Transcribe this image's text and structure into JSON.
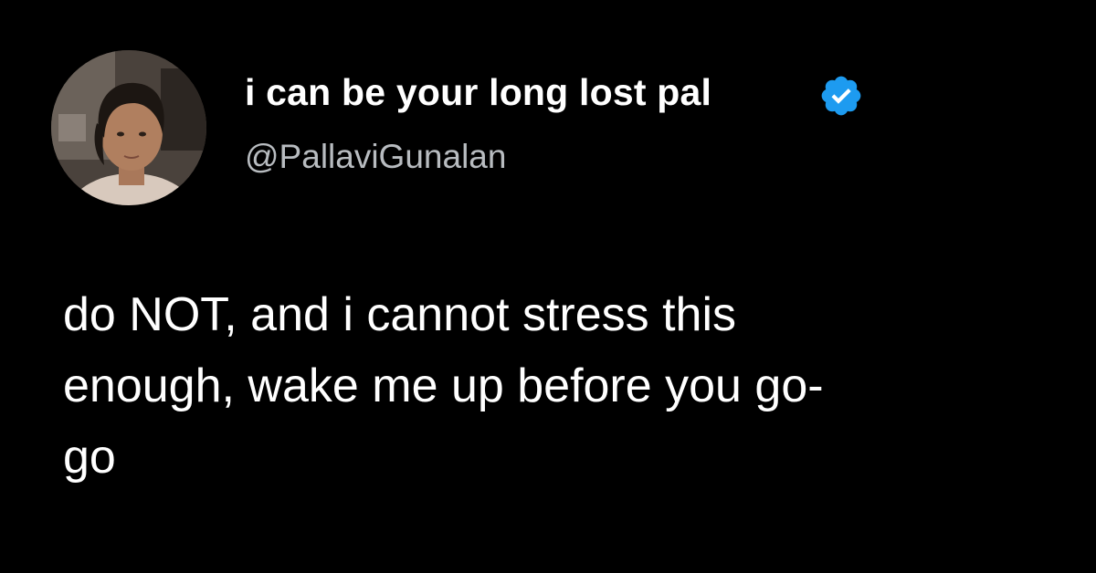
{
  "tweet": {
    "author": {
      "display_name": "i can be your long lost pal",
      "handle": "@PallaviGunalan",
      "verified": true,
      "avatar_icon": "profile-photo",
      "badge_icon": "verified-badge-icon",
      "badge_color": "#1d9bf0"
    },
    "text": "do NOT, and i cannot stress this\nenough, wake me up before you go-\ngo"
  },
  "theme": {
    "background": "#000000",
    "text_color": "#ffffff",
    "handle_color": "#b8bcc0"
  }
}
